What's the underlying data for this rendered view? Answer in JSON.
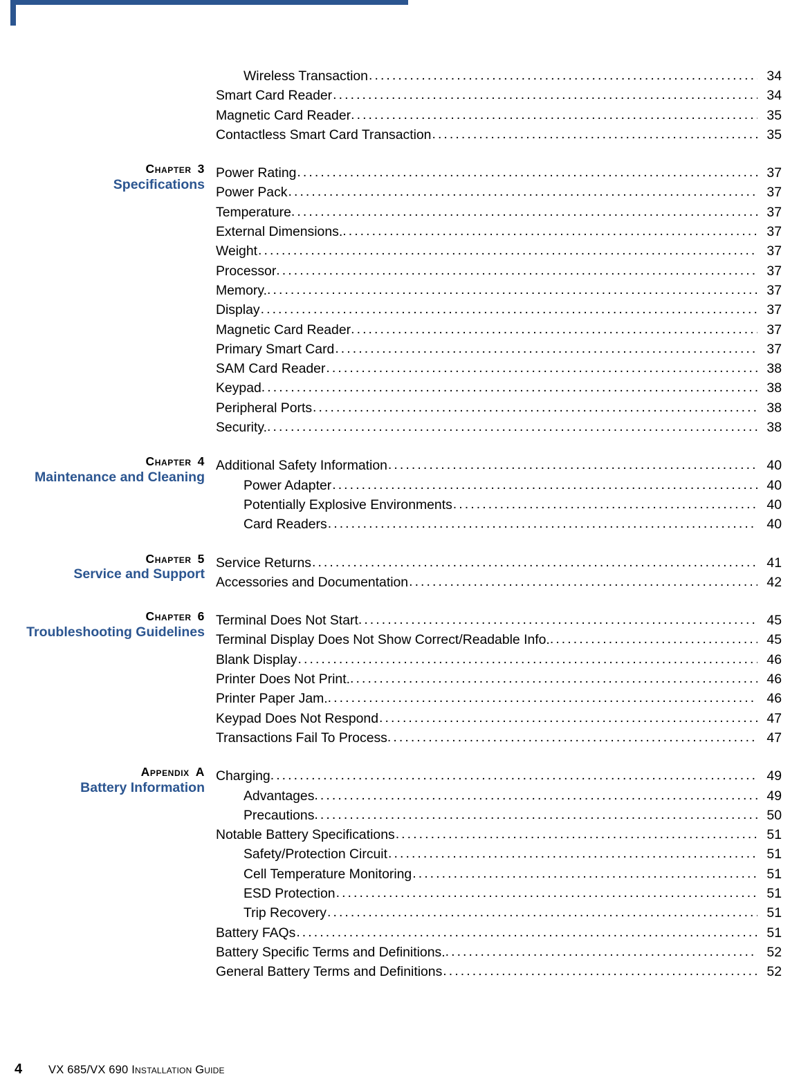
{
  "theme": {
    "accent_blue": "#2b5590",
    "text_black": "#000000",
    "page_background": "#ffffff"
  },
  "footer": {
    "page_number": "4",
    "document_title": "VX 685/VX 690 Installation Guide"
  },
  "toc": {
    "groups": [
      {
        "id": "continued-chapter-2",
        "chapter_kicker": "",
        "chapter_number": "",
        "chapter_title": "",
        "entries": [
          {
            "label": "Wireless Transaction",
            "page": "34",
            "indent": 1,
            "tight": false
          },
          {
            "label": "Smart Card Reader",
            "page": "34",
            "indent": 0,
            "tight": false
          },
          {
            "label": "Magnetic Card Reader",
            "page": "35",
            "indent": 0,
            "tight": true
          },
          {
            "label": "Contactless Smart Card Transaction",
            "page": "35",
            "indent": 0,
            "tight": false
          }
        ]
      },
      {
        "id": "chapter-3",
        "chapter_kicker": "Chapter",
        "chapter_number": "3",
        "chapter_title": "Specifications",
        "entries": [
          {
            "label": "Power Rating",
            "page": "37",
            "indent": 0,
            "tight": false
          },
          {
            "label": "Power Pack",
            "page": "37",
            "indent": 0,
            "tight": false
          },
          {
            "label": "Temperature",
            "page": "37",
            "indent": 0,
            "tight": true
          },
          {
            "label": "External Dimensions.",
            "page": "37",
            "indent": 0,
            "tight": true
          },
          {
            "label": "Weight",
            "page": "37",
            "indent": 0,
            "tight": false
          },
          {
            "label": "Processor",
            "page": "37",
            "indent": 0,
            "tight": true
          },
          {
            "label": "Memory.",
            "page": "37",
            "indent": 0,
            "tight": true
          },
          {
            "label": "Display",
            "page": "37",
            "indent": 0,
            "tight": false
          },
          {
            "label": "Magnetic Card Reader",
            "page": "37",
            "indent": 0,
            "tight": true
          },
          {
            "label": "Primary Smart Card",
            "page": "37",
            "indent": 0,
            "tight": false
          },
          {
            "label": "SAM Card Reader",
            "page": "38",
            "indent": 0,
            "tight": false
          },
          {
            "label": "Keypad",
            "page": "38",
            "indent": 0,
            "tight": true
          },
          {
            "label": "Peripheral Ports",
            "page": "38",
            "indent": 0,
            "tight": false
          },
          {
            "label": "Security.",
            "page": "38",
            "indent": 0,
            "tight": true
          }
        ]
      },
      {
        "id": "chapter-4",
        "chapter_kicker": "Chapter",
        "chapter_number": "4",
        "chapter_title": "Maintenance and Cleaning",
        "entries": [
          {
            "label": "Additional Safety Information",
            "page": "40",
            "indent": 0,
            "tight": false
          },
          {
            "label": "Power Adapter",
            "page": "40",
            "indent": 1,
            "tight": false
          },
          {
            "label": "Potentially Explosive Environments",
            "page": "40",
            "indent": 1,
            "tight": false
          },
          {
            "label": "Card Readers",
            "page": "40",
            "indent": 1,
            "tight": false
          }
        ]
      },
      {
        "id": "chapter-5",
        "chapter_kicker": "Chapter",
        "chapter_number": "5",
        "chapter_title": "Service and Support",
        "entries": [
          {
            "label": "Service Returns",
            "page": "41",
            "indent": 0,
            "tight": false
          },
          {
            "label": "Accessories and Documentation",
            "page": "42",
            "indent": 0,
            "tight": false
          }
        ]
      },
      {
        "id": "chapter-6",
        "chapter_kicker": "Chapter",
        "chapter_number": "6",
        "chapter_title": "Troubleshooting Guidelines",
        "entries": [
          {
            "label": "Terminal Does Not Start",
            "page": "45",
            "indent": 0,
            "tight": true
          },
          {
            "label": "Terminal Display Does Not Show Correct/Readable Info.",
            "page": "45",
            "indent": 0,
            "tight": true
          },
          {
            "label": "Blank Display",
            "page": "46",
            "indent": 0,
            "tight": false
          },
          {
            "label": "Printer Does Not Print.",
            "page": "46",
            "indent": 0,
            "tight": true
          },
          {
            "label": "Printer Paper Jam.",
            "page": "46",
            "indent": 0,
            "tight": true
          },
          {
            "label": "Keypad Does Not Respond",
            "page": "47",
            "indent": 0,
            "tight": false
          },
          {
            "label": "Transactions Fail To Process",
            "page": "47",
            "indent": 0,
            "tight": true
          }
        ]
      },
      {
        "id": "appendix-a",
        "chapter_kicker": "Appendix",
        "chapter_number": "A",
        "chapter_title": "Battery Information",
        "entries": [
          {
            "label": "Charging",
            "page": "49",
            "indent": 0,
            "tight": true
          },
          {
            "label": "Advantages",
            "page": "49",
            "indent": 1,
            "tight": true
          },
          {
            "label": "Precautions",
            "page": "50",
            "indent": 1,
            "tight": true
          },
          {
            "label": "Notable Battery Specifications",
            "page": "51",
            "indent": 0,
            "tight": false
          },
          {
            "label": "Safety/Protection Circuit",
            "page": "51",
            "indent": 1,
            "tight": false
          },
          {
            "label": "Cell Temperature Monitoring",
            "page": "51",
            "indent": 1,
            "tight": false
          },
          {
            "label": "ESD Protection",
            "page": "51",
            "indent": 1,
            "tight": false
          },
          {
            "label": "Trip Recovery",
            "page": "51",
            "indent": 1,
            "tight": false
          },
          {
            "label": "Battery FAQs",
            "page": "51",
            "indent": 0,
            "tight": false
          },
          {
            "label": "Battery Specific Terms and Definitions.",
            "page": "52",
            "indent": 0,
            "tight": true
          },
          {
            "label": "General Battery Terms and Definitions",
            "page": "52",
            "indent": 0,
            "tight": false
          }
        ]
      }
    ]
  }
}
